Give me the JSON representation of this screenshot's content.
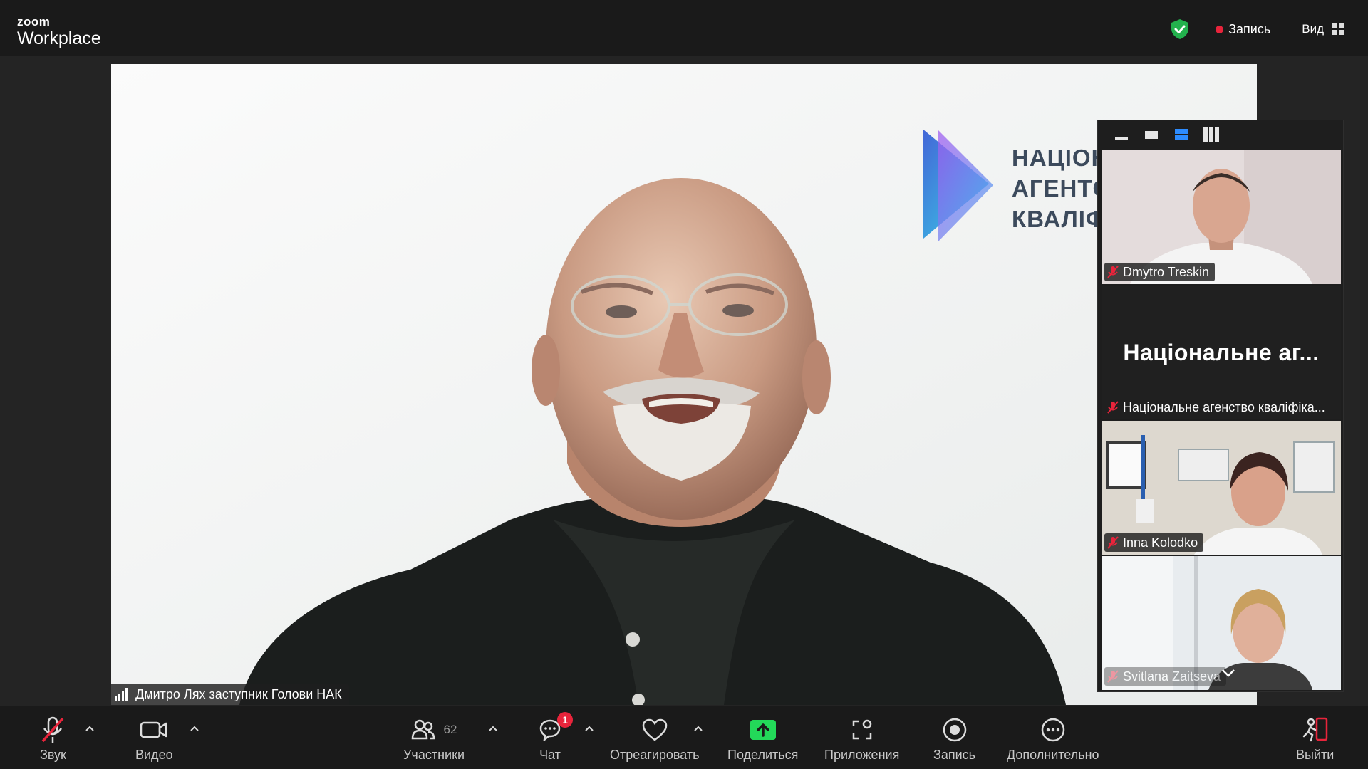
{
  "app": {
    "brand_small": "zoom",
    "brand_big": "Workplace"
  },
  "topbar": {
    "recording_label": "Запись",
    "view_label": "Вид"
  },
  "speaker": {
    "name_tag": "Дмитро Лях заступник Голови НАК",
    "logo_lines": [
      "НАЦІОН",
      "АГЕНТС",
      "КВАЛІФ"
    ]
  },
  "gallery": {
    "tiles": [
      {
        "name": "Dmytro Treskin",
        "muted": true
      },
      {
        "name": "Національне агенство кваліфіка...",
        "display_name": "Національне аг...",
        "muted": true
      },
      {
        "name": "Inna Kolodko",
        "muted": true
      },
      {
        "name": "Svitlana Zaitseva",
        "muted": true
      }
    ]
  },
  "toolbar": {
    "audio_label": "Звук",
    "video_label": "Видео",
    "participants_label": "Участники",
    "participants_count": "62",
    "chat_label": "Чат",
    "chat_badge": "1",
    "react_label": "Отреагировать",
    "share_label": "Поделиться",
    "apps_label": "Приложения",
    "record_label": "Запись",
    "more_label": "Дополнительно",
    "leave_label": "Выйти"
  },
  "colors": {
    "accent_blue": "#2d8cff",
    "share_green": "#23d959",
    "record_red": "#e8243b",
    "security_green": "#23b14d"
  }
}
